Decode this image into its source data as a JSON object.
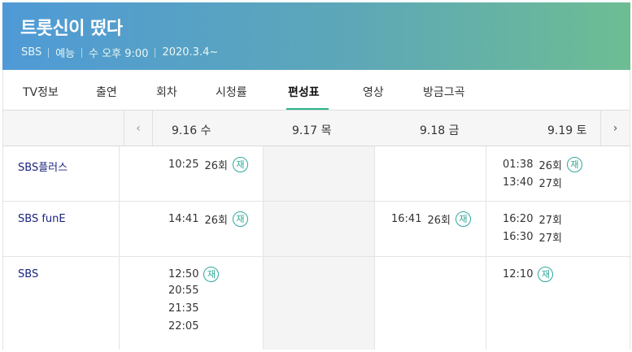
{
  "program": {
    "title": "트롯신이 떴다",
    "channel": "SBS",
    "genre": "예능",
    "airtime": "수 오후 9:00",
    "start_date": "2020.3.4~"
  },
  "tabs": [
    "TV정보",
    "출연",
    "회차",
    "시청률",
    "편성표",
    "영상",
    "방금그곡"
  ],
  "active_tab": "편성표",
  "nav": {
    "prev_icon": "chevron-left-icon",
    "next_icon": "chevron-right-icon"
  },
  "dates": [
    "9.16 수",
    "9.17 목",
    "9.18 금",
    "9.19 토"
  ],
  "rerun_badge": "재",
  "schedule": [
    {
      "channel": "SBS플러스",
      "days": [
        [
          {
            "time": "10:25",
            "ep": "26회",
            "rerun": true
          }
        ],
        [],
        [],
        [
          {
            "time": "01:38",
            "ep": "26회",
            "rerun": true
          },
          {
            "time": "13:40",
            "ep": "27회",
            "rerun": false
          }
        ]
      ]
    },
    {
      "channel": "SBS funE",
      "days": [
        [
          {
            "time": "14:41",
            "ep": "26회",
            "rerun": true
          }
        ],
        [],
        [
          {
            "time": "16:41",
            "ep": "26회",
            "rerun": true
          }
        ],
        [
          {
            "time": "16:20",
            "ep": "27회",
            "rerun": false
          },
          {
            "time": "16:30",
            "ep": "27회",
            "rerun": false
          }
        ]
      ]
    },
    {
      "channel": "SBS",
      "days": [
        [
          {
            "time": "12:50",
            "ep": "",
            "rerun": true
          },
          {
            "time": "20:55",
            "ep": "",
            "rerun": false
          },
          {
            "time": "21:35",
            "ep": "",
            "rerun": false
          },
          {
            "time": "22:05",
            "ep": "",
            "rerun": false
          }
        ],
        [],
        [],
        [
          {
            "time": "12:10",
            "ep": "",
            "rerun": true
          }
        ]
      ]
    }
  ]
}
